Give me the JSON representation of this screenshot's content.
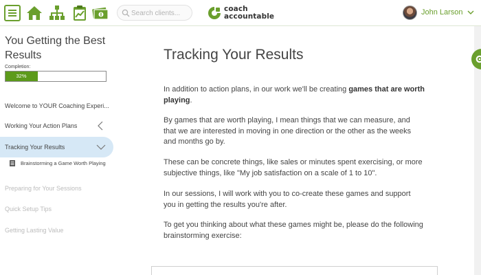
{
  "header": {
    "menu_icon": "hamburger-icon",
    "nav_icons": [
      "home-icon",
      "org-chart-icon",
      "clipboard-chart-icon",
      "money-icon"
    ],
    "search_placeholder": "Search clients...",
    "brand_line1": "coach",
    "brand_line2": "accountable",
    "user_name": "John Larson",
    "accent_color": "#6a9f2d"
  },
  "sidebar": {
    "title": "You Getting the Best Results",
    "completion_label": "Completion:",
    "completion_percent": 32,
    "completion_text": "32%",
    "items": [
      {
        "label": "Welcome to YOUR Coaching Experi...",
        "state": "normal"
      },
      {
        "label": "Working Your Action Plans",
        "state": "normal"
      },
      {
        "label": "Tracking Your Results",
        "state": "active"
      },
      {
        "label": "Preparing for Your Sessions",
        "state": "muted"
      },
      {
        "label": "Quick Setup Tips",
        "state": "muted"
      },
      {
        "label": "Getting Lasting Value",
        "state": "muted"
      }
    ],
    "subitem": "Brainstorming a Game Worth Playing",
    "active_bg": "#d6e8f6"
  },
  "main": {
    "title": "Tracking Your Results",
    "p1_before": "In addition to action plans, in our work we'll be creating ",
    "p1_bold": "games that are worth playing",
    "p1_after": ".",
    "p2": "By games that are worth playing, I mean things that we can measure, and that we are interested in moving in one direction or the other as the weeks and months go by.",
    "p3": "These can be concrete things, like sales or minutes spent exercising, or more subjective things, like \"My job satisfaction on a scale of 1 to 10\".",
    "p4": "In our sessions, I will work with you to co-create these games and support you in getting the results you're after.",
    "p5": "To get you thinking about what these games might be, please do the following brainstorming exercise:"
  }
}
